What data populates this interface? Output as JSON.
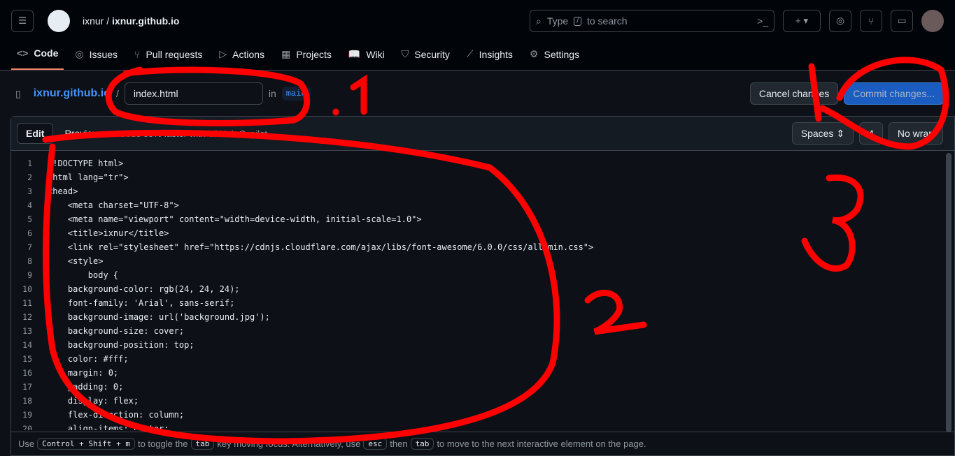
{
  "topbar": {
    "owner": "ixnur",
    "repo": "ixnur.github.io",
    "search_placeholder": "Type / to search",
    "search_pre": "Type",
    "search_key": "/",
    "search_post": "to search"
  },
  "nav": [
    {
      "label": "Code",
      "icon": "code-icon",
      "active": true
    },
    {
      "label": "Issues",
      "icon": "issue-icon"
    },
    {
      "label": "Pull requests",
      "icon": "pull-request-icon"
    },
    {
      "label": "Actions",
      "icon": "play-icon"
    },
    {
      "label": "Projects",
      "icon": "table-icon"
    },
    {
      "label": "Wiki",
      "icon": "book-icon"
    },
    {
      "label": "Security",
      "icon": "shield-icon"
    },
    {
      "label": "Insights",
      "icon": "graph-icon"
    },
    {
      "label": "Settings",
      "icon": "gear-icon"
    }
  ],
  "editor_header": {
    "repo_link": "ixnur.github.io",
    "separator": "/",
    "filename": "index.html",
    "in_label": "in",
    "branch": "main",
    "cancel": "Cancel changes",
    "commit": "Commit changes..."
  },
  "editor_toolbar": {
    "edit": "Edit",
    "preview": "Preview",
    "copilot": "Code 55% faster with GitHub Copilot",
    "indent_mode": "Spaces",
    "indent_size": "4",
    "wrap": "No wrap"
  },
  "code_lines": [
    "<!DOCTYPE html>",
    "<html lang=\"tr\">",
    "<head>",
    "    <meta charset=\"UTF-8\">",
    "    <meta name=\"viewport\" content=\"width=device-width, initial-scale=1.0\">",
    "    <title>ixnur</title>",
    "    <link rel=\"stylesheet\" href=\"https://cdnjs.cloudflare.com/ajax/libs/font-awesome/6.0.0/css/all.min.css\">",
    "    <style>",
    "        body {",
    "    background-color: rgb(24, 24, 24);",
    "    font-family: 'Arial', sans-serif;",
    "    background-image: url('background.jpg');",
    "    background-size: cover;",
    "    background-position: top;",
    "    color: #fff;",
    "    margin: 0;",
    "    padding: 0;",
    "    display: flex;",
    "    flex-direction: column;",
    "    align-items: center;"
  ],
  "footer": {
    "use": "Use",
    "shortcut": "Control + Shift + m",
    "t1": "to toggle the",
    "tab": "tab",
    "t2": "key moving focus. Alternatively, use",
    "esc": "esc",
    "then": "then",
    "t3": "to move to the next interactive element on the page."
  },
  "annotations": [
    "1",
    "2",
    "3",
    "4"
  ],
  "colors": {
    "accent": "#f78166",
    "link": "#4493f8",
    "annotation": "#ff0000"
  }
}
